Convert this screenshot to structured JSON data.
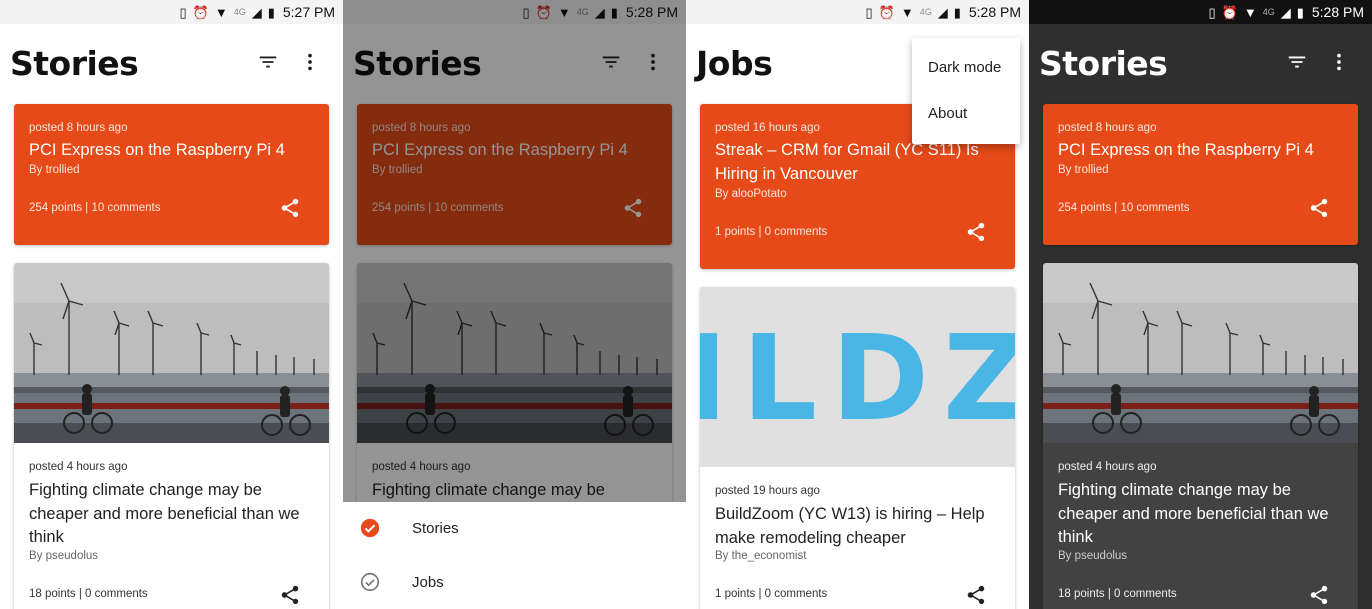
{
  "colors": {
    "accent": "#e64a19",
    "dark_bg": "#2f2f2f",
    "dark_card": "#424242",
    "logo_blue": "#4ab6e6"
  },
  "icons": [
    "phone-icon",
    "alarm-icon",
    "wifi-icon",
    "signal-icon",
    "battery-icon",
    "filter-icon",
    "more-vert-icon",
    "share-icon",
    "check-circle-icon",
    "check-circle-outline-icon"
  ],
  "panels": [
    {
      "status": {
        "time": "5:27 PM",
        "network": "4G"
      },
      "title": "Stories",
      "cards": [
        {
          "posted": "posted 8 hours ago",
          "title": "PCI Express on the Raspberry Pi 4",
          "by": "By trollied",
          "meta": "254 points | 10 comments"
        },
        {
          "posted": "posted 4 hours ago",
          "title": "Fighting climate change may be cheaper and more beneficial than we think",
          "by": "By pseudolus",
          "meta": "18 points | 0 comments"
        }
      ]
    },
    {
      "status": {
        "time": "5:28 PM",
        "network": "4G"
      },
      "title": "Stories",
      "cards": [
        {
          "posted": "posted 8 hours ago",
          "title": "PCI Express on the Raspberry Pi 4",
          "by": "By trollied",
          "meta": "254 points | 10 comments"
        },
        {
          "posted": "posted 4 hours ago",
          "title": "Fighting climate change may be"
        }
      ],
      "sheet": [
        {
          "label": "Stories",
          "selected": true
        },
        {
          "label": "Jobs",
          "selected": false
        }
      ]
    },
    {
      "status": {
        "time": "5:28 PM",
        "network": "4G"
      },
      "title": "Jobs",
      "menu": [
        "Dark mode",
        "About"
      ],
      "cards": [
        {
          "posted": "posted 16 hours ago",
          "title": "Streak – CRM for Gmail (YC S11) Is Hiring in Vancouver",
          "by": "By alooPotato",
          "meta": "1 points | 0 comments"
        },
        {
          "logo_text": "ILDZ",
          "posted": "posted 19 hours ago",
          "title": "BuildZoom (YC W13) is hiring – Help make remodeling cheaper",
          "by": "By the_economist",
          "meta": "1 points | 0 comments"
        }
      ]
    },
    {
      "status": {
        "time": "5:28 PM",
        "network": "4G"
      },
      "title": "Stories",
      "cards": [
        {
          "posted": "posted 8 hours ago",
          "title": "PCI Express on the Raspberry Pi 4",
          "by": "By trollied",
          "meta": "254 points | 10 comments"
        },
        {
          "posted": "posted 4 hours ago",
          "title": "Fighting climate change may be cheaper and more beneficial than we think",
          "by": "By pseudolus",
          "meta": "18 points | 0 comments"
        }
      ]
    }
  ]
}
